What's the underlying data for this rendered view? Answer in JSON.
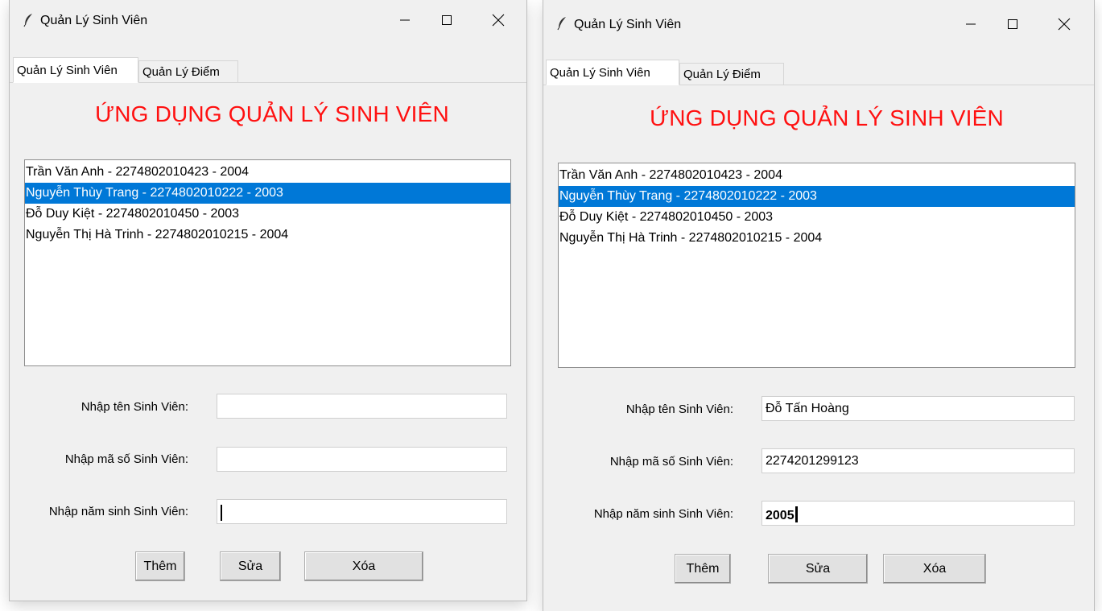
{
  "windows": [
    {
      "title": "Quản Lý Sinh Viên",
      "tabs": [
        {
          "label": "Quản Lý Sinh Viên",
          "active": true
        },
        {
          "label": "Quản Lý Điểm",
          "active": false
        }
      ],
      "heading": "ỨNG DỤNG QUẢN LÝ SINH VIÊN",
      "list": [
        {
          "text": "Trần Văn Anh - 2274802010423 - 2004",
          "selected": false
        },
        {
          "text": "Nguyễn Thùy Trang - 2274802010222 - 2003",
          "selected": true
        },
        {
          "text": "Đỗ Duy Kiệt  - 2274802010450 - 2003",
          "selected": false
        },
        {
          "text": "Nguyễn Thị Hà Trinh - 2274802010215 - 2004",
          "selected": false
        }
      ],
      "fields": {
        "name": {
          "label": "Nhập tên Sinh Viên:",
          "value": ""
        },
        "id": {
          "label": "Nhập mã số Sinh Viên:",
          "value": ""
        },
        "year": {
          "label": "Nhập năm sinh Sinh Viên:",
          "value": ""
        }
      },
      "buttons": {
        "add": "Thêm",
        "edit": "Sửa",
        "delete": "Xóa"
      }
    },
    {
      "title": "Quản Lý Sinh Viên",
      "tabs": [
        {
          "label": "Quản Lý Sinh Viên",
          "active": true
        },
        {
          "label": "Quản Lý Điểm",
          "active": false
        }
      ],
      "heading": "ỨNG DỤNG QUẢN LÝ SINH VIÊN",
      "list": [
        {
          "text": "Trần Văn Anh - 2274802010423 - 2004",
          "selected": false
        },
        {
          "text": "Nguyễn Thùy Trang - 2274802010222 - 2003",
          "selected": true
        },
        {
          "text": "Đỗ Duy Kiệt  - 2274802010450 - 2003",
          "selected": false
        },
        {
          "text": "Nguyễn Thị Hà Trinh - 2274802010215 - 2004",
          "selected": false
        }
      ],
      "fields": {
        "name": {
          "label": "Nhập tên Sinh Viên:",
          "value": "Đỗ Tấn Hoàng"
        },
        "id": {
          "label": "Nhập mã số Sinh Viên:",
          "value": "2274201299123"
        },
        "year": {
          "label": "Nhập năm sinh Sinh Viên:",
          "value": "2005"
        }
      },
      "buttons": {
        "add": "Thêm",
        "edit": "Sửa",
        "delete": "Xóa"
      }
    }
  ],
  "colors": {
    "heading": "#ff1010",
    "selection": "#0078d7",
    "window_bg": "#f0f0f0"
  },
  "icons": [
    "feather-icon",
    "minimize-icon",
    "maximize-icon",
    "close-icon"
  ]
}
